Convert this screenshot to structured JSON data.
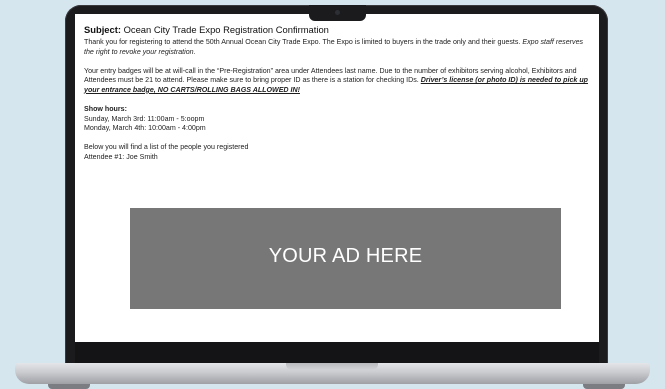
{
  "email": {
    "subject_label": "Subject:",
    "subject_text": " Ocean City Trade Expo Registration Confirmation",
    "intro_text": "Thank you for registering to attend the 50th Annual Ocean City Trade Expo. The Expo is limited to buyers in the trade only and their guests. ",
    "intro_italic": "Expo staff reserves the right to revoke your registration.",
    "badges_text": "Your entry badges will be at will-call in the “Pre-Registration” area under Attendees last name. Due to the number of exhibitors serving alcohol, Exhibitors and Attendees must be 21 to attend. Please make sure to bring proper ID as there is a station for checking IDs. ",
    "badges_emphasis": "Driver’s license (or photo ID) is needed to pick up your entrance badge, NO CARTS/ROLLING BAGS ALLOWED IN!",
    "show_hours_label": "Show hours:",
    "show_hours": [
      "Sunday, March 3rd: 11:00am - 5:oopm",
      "Monday, March 4th: 10:00am - 4:00pm"
    ],
    "list_intro": "Below you will find a list of the people you registered",
    "attendee_line": "Attendee #1: Joe Smith"
  },
  "ad": {
    "label": "YOUR AD HERE"
  },
  "colors": {
    "background": "#d5e6ef",
    "bezel": "#1b1b1d",
    "ad_box": "#777777",
    "text": "#1e1e1e"
  }
}
